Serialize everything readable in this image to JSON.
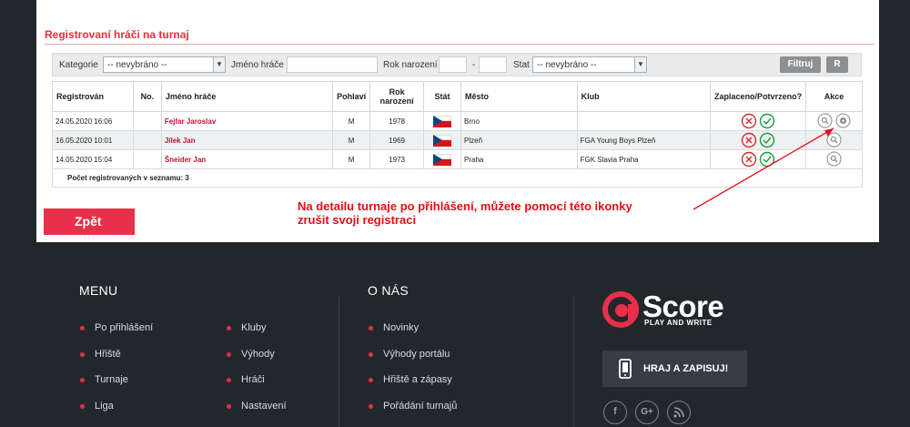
{
  "section": {
    "title": "Registrovaní hráči na turnaj"
  },
  "filters": {
    "category_label": "Kategorie",
    "category_value": "-- nevybráno --",
    "name_label": "Jméno hráče",
    "name_value": "",
    "birth_year_label": "Rok narození",
    "birth_year_from": "",
    "birth_year_sep": "-",
    "birth_year_to": "",
    "country_label": "Stat",
    "country_value": "-- nevybráno --",
    "filter_button": "Filtruj",
    "reset_button": "R"
  },
  "table": {
    "headers": {
      "registered": "Registrován",
      "no": "No.",
      "name": "Jméno hráče",
      "hand": "Pohlaví",
      "year_line1": "Rok",
      "year_line2": "narození",
      "country": "Stát",
      "city": "Město",
      "club": "Klub",
      "paid": "Zaplaceno/Potvrzeno?",
      "actions": "Akce"
    },
    "rows": [
      {
        "registered": "24.05.2020 16:06",
        "no": "",
        "name": "Fejfar Jaroslav",
        "gender": "M",
        "year": "1978",
        "city": "Brno",
        "club": ""
      },
      {
        "registered": "16.05.2020 10:01",
        "no": "",
        "name": "Jílek Jan",
        "gender": "M",
        "year": "1969",
        "city": "Plzeň",
        "club": "FGA Young Boys Plzeň"
      },
      {
        "registered": "14.05.2020 15:04",
        "no": "",
        "name": "Šneider Jan",
        "gender": "M",
        "year": "1973",
        "city": "Praha",
        "club": "FGK Slavia Praha"
      }
    ],
    "count_text": "Počet registrovaných v seznamu: 3"
  },
  "annotation": {
    "line1": "Na detailu turnaje po přihlášení, můžete pomocí této ikonky",
    "line2": "zrušit svoji registraci"
  },
  "back_button": "Zpět",
  "footer": {
    "menu_heading": "MENU",
    "menu_col1": [
      "Po přihlášení",
      "Hřiště",
      "Turnaje",
      "Liga"
    ],
    "menu_col2": [
      "Kluby",
      "Výhody",
      "Hráči",
      "Nastavení"
    ],
    "about_heading": "O NÁS",
    "about_links": [
      "Novinky",
      "Výhody portálu",
      "Hřiště a zápasy",
      "Pořádání turnajů"
    ],
    "logo_word": "Score",
    "logo_tag": "PLAY AND WRITE",
    "app_button": "HRAJ A ZAPISUJ!",
    "social": [
      "f",
      "G+",
      "rss"
    ]
  },
  "colors": {
    "accent": "#e8304a",
    "footer_bg": "#22272b",
    "ok_green": "#1a9a3a",
    "cancel_red": "#d62b2b"
  }
}
